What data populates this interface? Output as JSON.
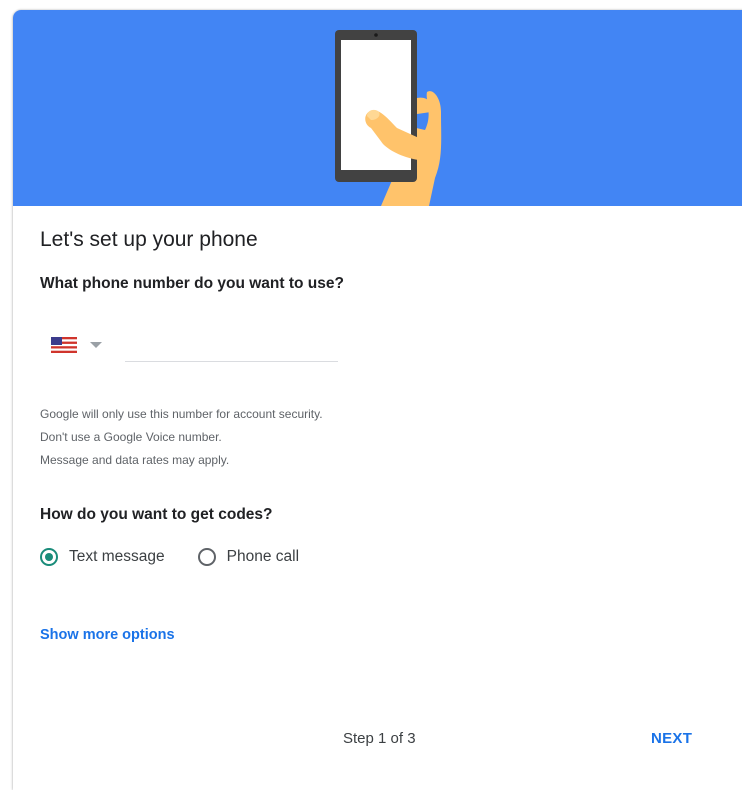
{
  "header": {
    "illustration_icon": "hand-holding-phone-icon",
    "background_color": "#4285f4"
  },
  "setup": {
    "title": "Let's set up your phone",
    "phone_question": "What phone number do you want to use?"
  },
  "phone": {
    "country_flag_icon": "us-flag-icon",
    "number_value": "",
    "number_placeholder": ""
  },
  "notes": {
    "line1": "Google will only use this number for account security.",
    "line2": "Don't use a Google Voice number.",
    "line3": "Message and data rates may apply."
  },
  "codes": {
    "question": "How do you want to get codes?",
    "options": [
      {
        "label": "Text message",
        "selected": true
      },
      {
        "label": "Phone call",
        "selected": false
      }
    ],
    "selected_color": "#1a8c7a"
  },
  "more_options": {
    "label": "Show more options"
  },
  "footer": {
    "step": "Step 1 of 3",
    "next_label": "NEXT",
    "accent_color": "#1a73e8"
  }
}
